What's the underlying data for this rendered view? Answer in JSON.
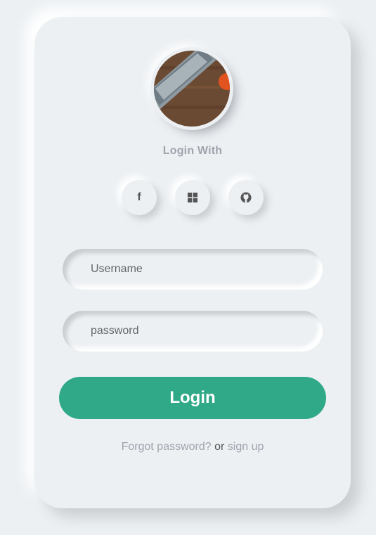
{
  "login": {
    "title": "Login With",
    "social": [
      {
        "icon": "facebook-icon"
      },
      {
        "icon": "windows-icon"
      },
      {
        "icon": "github-icon"
      }
    ],
    "username_placeholder": "Username",
    "password_placeholder": "password",
    "button_label": "Login",
    "forgot_label": "Forgot password?",
    "or_label": "or",
    "signup_label": "sign up"
  },
  "colors": {
    "background": "#ecf0f3",
    "accent": "#2fa987",
    "muted_text": "#a1a4ad"
  }
}
